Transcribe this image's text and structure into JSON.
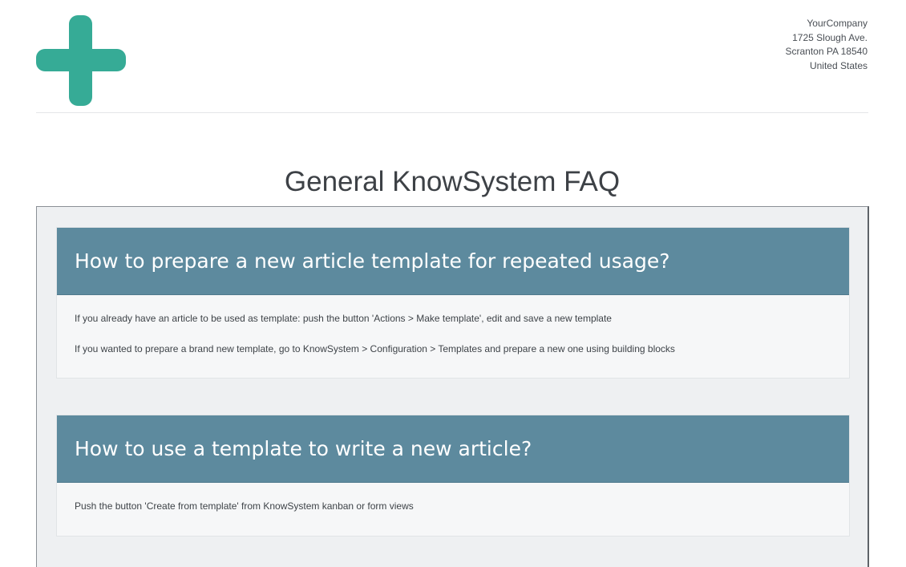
{
  "company": {
    "name": "YourCompany",
    "street": "1725 Slough Ave.",
    "city_line": "Scranton PA 18540",
    "country": "United States",
    "logo_icon": "plus-logo-icon",
    "brand_color": "#36ab96"
  },
  "document": {
    "title": "General KnowSystem FAQ"
  },
  "faq": [
    {
      "question": "How to prepare a new article template for repeated usage?",
      "answers": [
        "If you already have an article to be used as template: push the button 'Actions > Make template', edit and save a new template",
        "If you wanted to prepare a brand new template, go to KnowSystem > Configuration > Templates and prepare a new one using building blocks"
      ]
    },
    {
      "question": "How to use a template to write a new article?",
      "answers": [
        "Push the button 'Create from template' from KnowSystem kanban or form views"
      ]
    }
  ],
  "colors": {
    "card_header": "#5d8a9e",
    "panel_background": "#eef0f2"
  }
}
